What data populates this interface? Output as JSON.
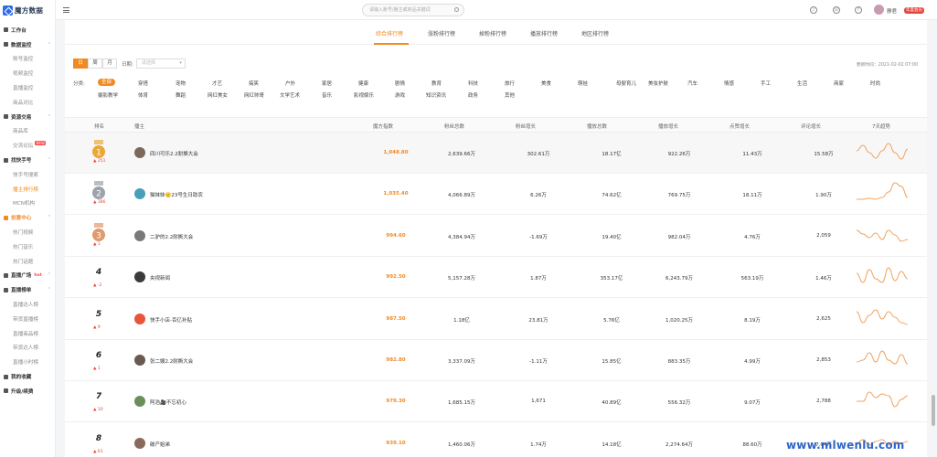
{
  "app": {
    "logo_text": "魔方数据"
  },
  "header": {
    "search_placeholder": "请输入账号/播主或商品关键词",
    "user_name": "静君",
    "vip_label": "年度会员"
  },
  "sidebar": {
    "items": [
      {
        "label": "工作台",
        "type": "group"
      },
      {
        "label": "数据监控",
        "type": "group",
        "chev": "⌃"
      },
      {
        "label": "账号监控",
        "type": "sub"
      },
      {
        "label": "视频监控",
        "type": "sub"
      },
      {
        "label": "直播监控",
        "type": "sub"
      },
      {
        "label": "商品对比",
        "type": "sub"
      },
      {
        "label": "资源交易",
        "type": "group",
        "chev": "⌃"
      },
      {
        "label": "商品库",
        "type": "sub"
      },
      {
        "label": "交流论坛",
        "type": "sub",
        "badge": "NEW"
      },
      {
        "label": "找快手号",
        "type": "group",
        "chev": "⌃"
      },
      {
        "label": "快手号搜索",
        "type": "sub"
      },
      {
        "label": "播主排行榜",
        "type": "sub",
        "active": true
      },
      {
        "label": "MCN机构",
        "type": "sub"
      },
      {
        "label": "创意中心",
        "type": "group",
        "orange": true,
        "chev": "⌃"
      },
      {
        "label": "热门视频",
        "type": "sub"
      },
      {
        "label": "热门音乐",
        "type": "sub"
      },
      {
        "label": "热门话题",
        "type": "sub"
      },
      {
        "label": "直播广场",
        "type": "group",
        "hot": "hot",
        "chev": "⌃"
      },
      {
        "label": "直播榜单",
        "type": "group",
        "chev": "⌃"
      },
      {
        "label": "直播达人榜",
        "type": "sub"
      },
      {
        "label": "带货直播榜",
        "type": "sub"
      },
      {
        "label": "直播商品榜",
        "type": "sub"
      },
      {
        "label": "带货达人榜",
        "type": "sub"
      },
      {
        "label": "直播小时榜",
        "type": "sub"
      },
      {
        "label": "我的收藏",
        "type": "group"
      },
      {
        "label": "升级/续费",
        "type": "group"
      }
    ]
  },
  "tabs": [
    "综合排行榜",
    "涨粉排行榜",
    "掉粉排行榜",
    "播放排行榜",
    "地区排行榜"
  ],
  "filters": {
    "segments": [
      "日",
      "周",
      "月"
    ],
    "date_label": "日期:",
    "date_placeholder": "请选择",
    "update_time": "更新时间：2021-02-02 07:00",
    "category_label": "分类:",
    "categories_row1": [
      "全部",
      "穿搭",
      "宠物",
      "才艺",
      "搞笑",
      "户外",
      "家居",
      "健康",
      "剧情",
      "教育",
      "科技",
      "旅行",
      "美食",
      "萌娃",
      "母婴育儿",
      "美妆护肤",
      "汽车",
      "情感",
      "手工",
      "生活",
      "商家",
      "时尚"
    ],
    "categories_row2": [
      "摄影教学",
      "体育",
      "舞蹈",
      "网红美女",
      "网红帅哥",
      "文学艺术",
      "音乐",
      "影视娱乐",
      "游戏",
      "知识资讯",
      "政务",
      "其他"
    ]
  },
  "table": {
    "headers": [
      "排名",
      "播主",
      "魔方指数",
      "粉丝总数",
      "粉丝增长",
      "播放总数",
      "播放增长",
      "点赞增长",
      "评论增长",
      "7天趋势"
    ],
    "rows": [
      {
        "rank": "1",
        "change": "▲ 251",
        "name": "四川可乐2.2耐撕大会",
        "index": "1,048.80",
        "fans": "2,639.66万",
        "fans_growth": "302.61万",
        "plays": "18.17亿",
        "plays_growth": "922.26万",
        "likes": "11.43万",
        "comments": "15.58万",
        "trend": [
          14,
          20,
          12,
          6,
          14,
          22,
          12,
          5,
          16
        ]
      },
      {
        "rank": "2",
        "change": "▲ 386",
        "name": "猫妹妹🙂23号生日助农",
        "index": "1,035.40",
        "fans": "4,066.89万",
        "fans_growth": "6.26万",
        "plays": "74.62亿",
        "plays_growth": "769.75万",
        "likes": "18.11万",
        "comments": "1.90万",
        "trend": [
          6,
          6,
          7,
          6,
          8,
          14,
          24,
          20,
          8
        ]
      },
      {
        "rank": "3",
        "change": "▲ 1",
        "name": "二驴的2.2耐撕大会",
        "index": "994.60",
        "fans": "4,384.94万",
        "fans_growth": "-1.69万",
        "plays": "19.40亿",
        "plays_growth": "982.04万",
        "likes": "4.76万",
        "comments": "2,059",
        "trend": [
          18,
          14,
          10,
          15,
          8,
          18,
          13,
          6,
          8
        ]
      },
      {
        "rank": "4",
        "change": "▲ -2",
        "name": "央视新闻",
        "index": "992.50",
        "fans": "5,157.28万",
        "fans_growth": "1.87万",
        "plays": "353.17亿",
        "plays_growth": "6,243.79万",
        "likes": "563.19万",
        "comments": "1.46万",
        "trend": [
          16,
          6,
          20,
          10,
          6,
          22,
          8,
          18,
          10
        ]
      },
      {
        "rank": "5",
        "change": "▲ 9",
        "name": "快手小店-百亿补贴",
        "index": "987.50",
        "fans": "1.18亿",
        "fans_growth": "23.81万",
        "plays": "5.76亿",
        "plays_growth": "1,020.25万",
        "likes": "8.19万",
        "comments": "2,625",
        "trend": [
          20,
          8,
          16,
          22,
          12,
          20,
          14,
          8,
          6
        ]
      },
      {
        "rank": "6",
        "change": "▲ 1",
        "name": "张二嫂2.2耐撕大会",
        "index": "982.80",
        "fans": "3,337.09万",
        "fans_growth": "-1.11万",
        "plays": "15.85亿",
        "plays_growth": "883.35万",
        "likes": "4.99万",
        "comments": "2,853",
        "trend": [
          10,
          12,
          20,
          10,
          22,
          12,
          8,
          18,
          8
        ]
      },
      {
        "rank": "7",
        "change": "▲ 10",
        "name": "阿浩🎥不忘初心",
        "index": "979.30",
        "fans": "1,685.15万",
        "fans_growth": "1,671",
        "plays": "40.89亿",
        "plays_growth": "556.32万",
        "likes": "9.07万",
        "comments": "2,788",
        "trend": [
          12,
          12,
          22,
          16,
          20,
          18,
          6,
          14,
          18
        ]
      },
      {
        "rank": "8",
        "change": "▲ 61",
        "name": "破产姐弟",
        "index": "939.10",
        "fans": "1,460.06万",
        "fans_growth": "1.74万",
        "plays": "14.18亿",
        "plays_growth": "2,274.64万",
        "likes": "88.60万",
        "comments": "7.04万",
        "trend": [
          12,
          16,
          10,
          14,
          16,
          10,
          14,
          12,
          14
        ]
      }
    ]
  },
  "watermark": "www.mlwenlu.com",
  "colors": {
    "accent": "#f08a24",
    "gold": "#e9a93a",
    "silver": "#9da3ab",
    "bronze": "#e09a6d",
    "trend": "#f0a460"
  }
}
